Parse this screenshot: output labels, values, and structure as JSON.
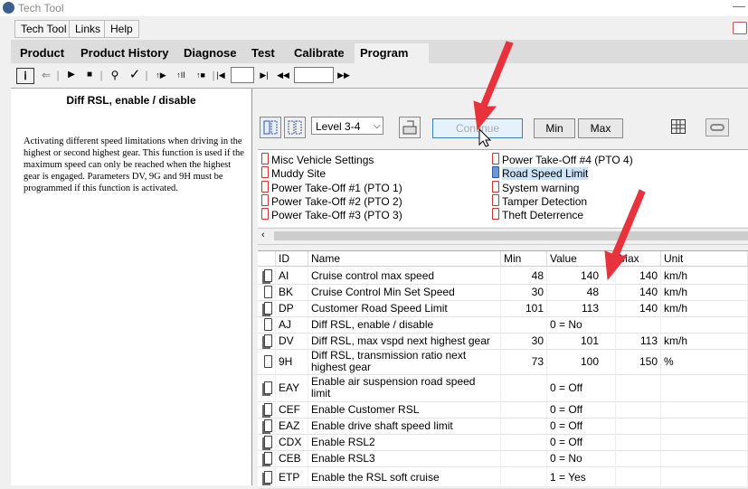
{
  "window": {
    "title": "Tech Tool"
  },
  "menu": [
    "Tech Tool",
    "Links",
    "Help"
  ],
  "tabs": [
    "Product",
    "Product History",
    "Diagnose",
    "Test",
    "Calibrate",
    "Program"
  ],
  "active_tab": "Program",
  "toolbar": {
    "glyphs": [
      "ⅰ",
      "⇐",
      "|",
      "▶",
      "■",
      "|",
      "⚲",
      "✓",
      "|",
      "↑▶",
      "↑II",
      "↑■",
      "|",
      "|◀"
    ],
    "next_glyphs": [
      "▶|",
      "◀◀"
    ],
    "last_glyph": "▶▶"
  },
  "left_panel": {
    "title": "Diff RSL, enable / disable",
    "description": "Activating different speed limitations when driving in the highest or second highest gear. This function is used if the maximum speed can only be reached when the highest gear is engaged. Parameters DV, 9G and 9H must be programmed if this function is activated."
  },
  "controls": {
    "level_select": "Level 3-4",
    "continue_label": "Continue",
    "min_label": "Min",
    "max_label": "Max"
  },
  "groups_left": [
    "Misc Vehicle Settings",
    "Muddy Site",
    "Power Take-Off #1 (PTO 1)",
    "Power Take-Off #2 (PTO 2)",
    "Power Take-Off #3 (PTO 3)"
  ],
  "groups_right": [
    "Power Take-Off #4 (PTO 4)",
    "Road Speed Limit",
    "System warning",
    "Tamper Detection",
    "Theft Deterrence"
  ],
  "selected_group": "Road Speed Limit",
  "table": {
    "headers": [
      "ID",
      "Name",
      "Min",
      "Value",
      "Max",
      "Unit"
    ],
    "rows": [
      {
        "id": "AI",
        "name": "Cruise control max speed",
        "min": "48",
        "value": "140",
        "max": "140",
        "unit": "km/h"
      },
      {
        "id": "BK",
        "name": "Cruise Control Min Set Speed",
        "min": "30",
        "value": "48",
        "max": "140",
        "unit": "km/h"
      },
      {
        "id": "DP",
        "name": "Customer Road Speed Limit",
        "min": "101",
        "value": "113",
        "max": "140",
        "unit": "km/h"
      },
      {
        "id": "AJ",
        "name": "Diff RSL, enable / disable",
        "min": "",
        "value": "0 = No",
        "max": "",
        "unit": ""
      },
      {
        "id": "DV",
        "name": "Diff RSL, max vspd next highest gear",
        "min": "30",
        "value": "101",
        "max": "113",
        "unit": "km/h"
      },
      {
        "id": "9H",
        "name": "Diff RSL, transmission ratio next highest gear",
        "min": "73",
        "value": "100",
        "max": "150",
        "unit": "%"
      },
      {
        "id": "EAY",
        "name": "Enable air suspension road speed limit",
        "min": "",
        "value": "0 = Off",
        "max": "",
        "unit": ""
      },
      {
        "id": "CEF",
        "name": "Enable Customer RSL",
        "min": "",
        "value": "0 = Off",
        "max": "",
        "unit": ""
      },
      {
        "id": "EAZ",
        "name": "Enable drive shaft speed limit",
        "min": "",
        "value": "0 = Off",
        "max": "",
        "unit": ""
      },
      {
        "id": "CDX",
        "name": "Enable RSL2",
        "min": "",
        "value": "0 = Off",
        "max": "",
        "unit": ""
      },
      {
        "id": "CEB",
        "name": "Enable RSL3",
        "min": "",
        "value": "0 = No",
        "max": "",
        "unit": ""
      },
      {
        "id": "ETP",
        "name": "Enable the RSL soft cruise",
        "min": "",
        "value": "1 = Yes",
        "max": "",
        "unit": ""
      }
    ]
  },
  "colors": {
    "arrow": "#e8323c",
    "selection": "#cce4fb"
  }
}
